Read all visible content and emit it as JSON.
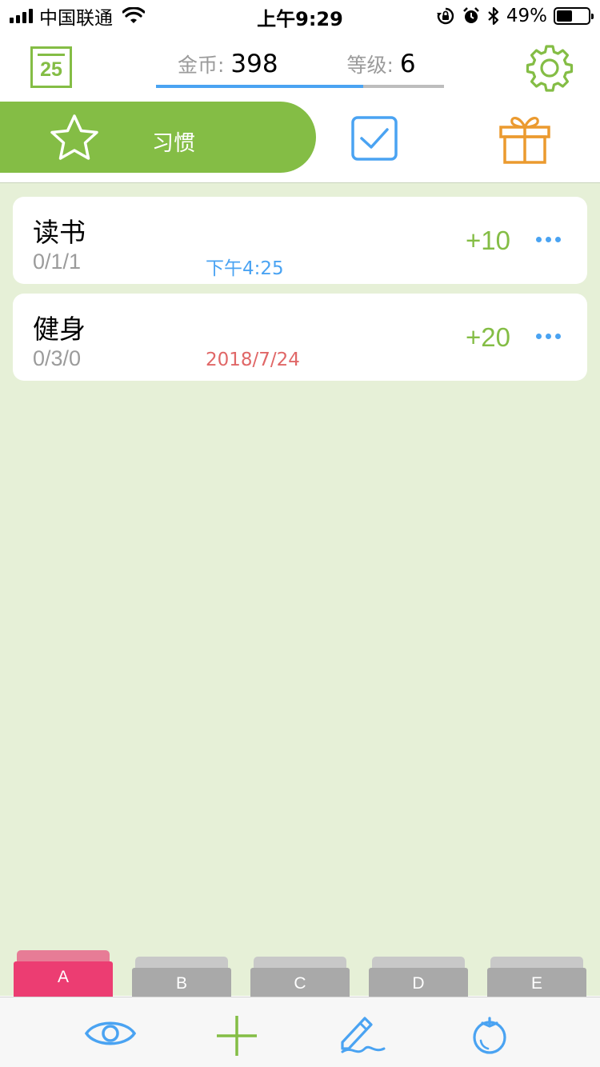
{
  "status_bar": {
    "carrier": "中国联通",
    "time": "上午9:29",
    "battery_pct": "49%",
    "battery_level": 0.49,
    "icons": [
      "signal-icon",
      "wifi-icon",
      "orientation-lock-icon",
      "alarm-icon",
      "bluetooth-icon",
      "battery-icon"
    ]
  },
  "header": {
    "calendar_day": "25",
    "coins_label": "金币:",
    "coins_value": "398",
    "level_label": "等级:",
    "level_value": "6",
    "level_progress": 0.72,
    "icons": [
      "calendar-icon",
      "gear-icon"
    ]
  },
  "tabs": [
    {
      "id": "habits",
      "label": "习惯",
      "icon": "star-icon",
      "active": true
    },
    {
      "id": "todos",
      "label": "",
      "icon": "checkbox-icon",
      "active": false
    },
    {
      "id": "rewards",
      "label": "",
      "icon": "gift-icon",
      "active": false
    }
  ],
  "habits": [
    {
      "name": "读书",
      "count": "0/1/1",
      "date": "下午4:25",
      "date_color": "#4aa3f2",
      "points": "+10"
    },
    {
      "name": "健身",
      "count": "0/3/0",
      "date": "2018/7/24",
      "date_color": "#e06767",
      "points": "+20"
    }
  ],
  "folders": [
    {
      "label": "A",
      "active": true
    },
    {
      "label": "B",
      "active": false
    },
    {
      "label": "C",
      "active": false
    },
    {
      "label": "D",
      "active": false
    },
    {
      "label": "E",
      "active": false
    }
  ],
  "toolbar": [
    "eye-icon",
    "plus-icon",
    "pencil-icon",
    "tomato-icon"
  ],
  "colors": {
    "accent_green": "#84bd45",
    "accent_blue": "#4aa3f2",
    "gift_orange": "#eb9a2f",
    "folder_active": "#ec3d72",
    "folder_inactive": "#a9a9a9",
    "background": "#e6f0d7"
  }
}
